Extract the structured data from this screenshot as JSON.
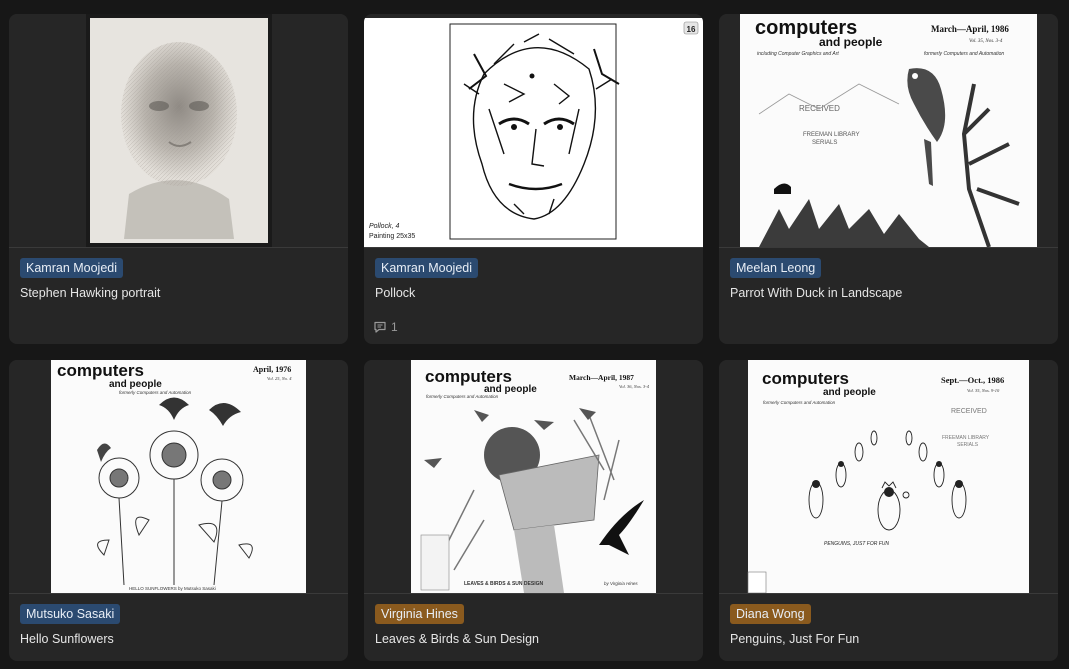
{
  "colors": {
    "page_bg": "#171717",
    "card_bg": "#262626",
    "tag_blue": "#2b4a70",
    "tag_orange": "#8a5a1e"
  },
  "cards": [
    {
      "author": "Kamran Moojedi",
      "author_color": "#2b4a70",
      "title": "Stephen Hawking portrait",
      "comments": null
    },
    {
      "author": "Kamran Moojedi",
      "author_color": "#2b4a70",
      "title": "Pollock",
      "comments": "1",
      "comment_icon": "comment-bubble-icon",
      "image_text": {
        "badge": "16",
        "caption_line1": "Pollock, 4",
        "caption_line2": "Painting   25x35"
      }
    },
    {
      "author": "Meelan Leong",
      "author_color": "#2b4a70",
      "title": "Parrot With Duck in Landscape",
      "comments": null,
      "image_text": {
        "masthead1": "computers",
        "masthead2": "and people",
        "subtitle": "including Computer Graphics and Art",
        "date": "March—April, 1986",
        "volume": "Vol. 35, Nos. 3-4",
        "formerly": "formerly Computers and Automation",
        "stamp": "RECEIVED",
        "stamp2": "FREEMAN LIBRARY",
        "stamp3": "SERIALS"
      }
    },
    {
      "author": "Mutsuko Sasaki",
      "author_color": "#2b4a70",
      "title": "Hello Sunflowers",
      "comments": null,
      "image_text": {
        "masthead1": "computers",
        "masthead2": "and people",
        "formerly": "formerly Computers and Automation",
        "date": "April, 1976",
        "volume": "Vol. 25, No. 4",
        "caption": "HELLO SUNFLOWERS by Mutsuko Sasaki"
      }
    },
    {
      "author": "Virginia Hines",
      "author_color": "#8a5a1e",
      "title": "Leaves & Birds & Sun Design",
      "comments": null,
      "image_text": {
        "masthead1": "computers",
        "masthead2": "and people",
        "formerly": "formerly Computers and Automation",
        "date": "March—April, 1987",
        "volume": "Vol. 36, Nos. 3-4",
        "caption": "LEAVES & BIRDS & SUN DESIGN",
        "byline": "by Virginia Hines"
      }
    },
    {
      "author": "Diana Wong",
      "author_color": "#8a5a1e",
      "title": "Penguins, Just For Fun",
      "comments": null,
      "image_text": {
        "masthead1": "computers",
        "masthead2": "and people",
        "formerly": "formerly Computers and Automation",
        "date": "Sept.—Oct., 1986",
        "volume": "Vol. 35, Nos. 9-10",
        "stamp": "RECEIVED",
        "stamp2": "FREEMAN LIBRARY",
        "stamp3": "SERIALS",
        "caption": "PENGUINS, JUST FOR FUN"
      }
    }
  ]
}
